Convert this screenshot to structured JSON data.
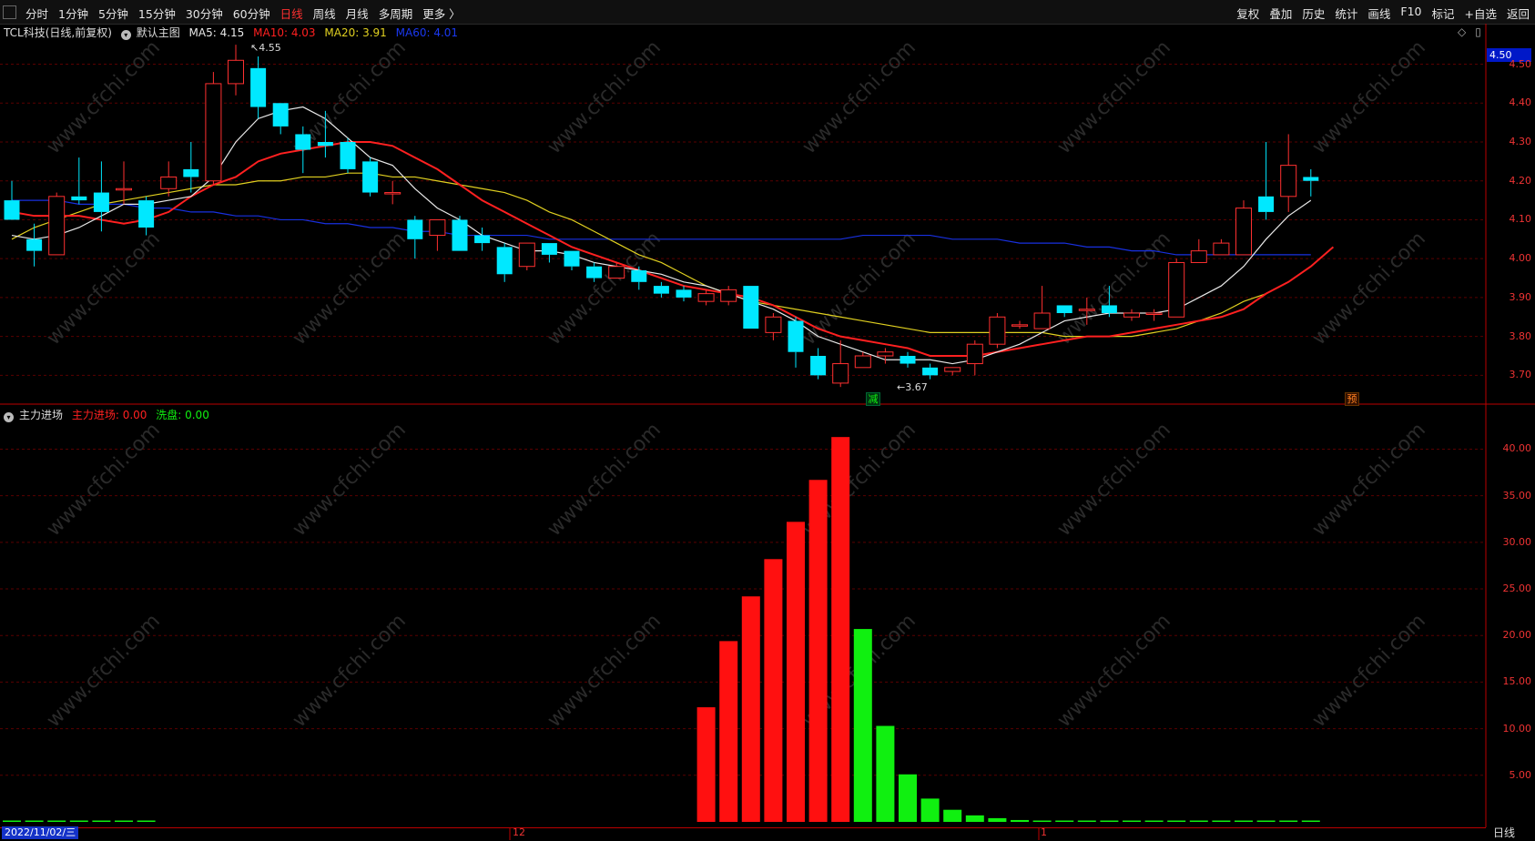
{
  "toolbar": {
    "left_items": [
      "分时",
      "1分钟",
      "5分钟",
      "15分钟",
      "30分钟",
      "60分钟",
      "日线",
      "周线",
      "月线",
      "多周期",
      "更多 〉"
    ],
    "active": "日线",
    "right_items": [
      "复权",
      "叠加",
      "历史",
      "统计",
      "画线",
      "F10",
      "标记",
      "+自选",
      "返回"
    ]
  },
  "main_panel": {
    "stock_title": "TCL科技(日线,前复权)",
    "template": "默认主图",
    "ma5": "MA5: 4.15",
    "ma10": "MA10: 4.03",
    "ma20": "MA20: 3.91",
    "ma60": "MA60: 4.01",
    "current_price_tag": "4.50",
    "y_ticks": [
      "4.50",
      "4.40",
      "4.30",
      "4.20",
      "4.10",
      "4.00",
      "3.90",
      "3.80",
      "3.70"
    ],
    "high_label": "4.55",
    "low_label": "3.67",
    "mark_reduce": "减",
    "mark_pre": "预"
  },
  "sub_panel": {
    "indicator_name": "主力进场",
    "main_in": "主力进场: 0.00",
    "wash": "洗盘: 0.00",
    "y_ticks": [
      "40.00",
      "35.00",
      "30.00",
      "25.00",
      "20.00",
      "15.00",
      "10.00",
      "5.00"
    ]
  },
  "date_axis": {
    "cursor_date": "2022/11/02/三",
    "month_labels": [
      "12",
      "1"
    ],
    "period_tab": "日线"
  },
  "colors": {
    "up": "#ff3030",
    "down": "#00e8ff",
    "ma5": "#e8e8e8",
    "ma10": "#ff2020",
    "ma20": "#e0d020",
    "ma60": "#1830e0",
    "bar_red": "#ff1010",
    "bar_green": "#10f010"
  },
  "chart_data": {
    "type": "candlestick",
    "title": "TCL科技(日线,前复权)",
    "ylim": [
      3.64,
      4.52
    ],
    "candles": [
      {
        "o": 4.15,
        "h": 4.2,
        "l": 4.1,
        "c": 4.1
      },
      {
        "o": 4.05,
        "h": 4.09,
        "l": 3.98,
        "c": 4.02
      },
      {
        "o": 4.01,
        "h": 4.17,
        "l": 4.01,
        "c": 4.16
      },
      {
        "o": 4.16,
        "h": 4.26,
        "l": 4.14,
        "c": 4.15
      },
      {
        "o": 4.17,
        "h": 4.25,
        "l": 4.07,
        "c": 4.12
      },
      {
        "o": 4.18,
        "h": 4.25,
        "l": 4.14,
        "c": 4.18
      },
      {
        "o": 4.15,
        "h": 4.16,
        "l": 4.06,
        "c": 4.08
      },
      {
        "o": 4.18,
        "h": 4.25,
        "l": 4.16,
        "c": 4.21
      },
      {
        "o": 4.23,
        "h": 4.3,
        "l": 4.17,
        "c": 4.21
      },
      {
        "o": 4.2,
        "h": 4.48,
        "l": 4.19,
        "c": 4.45
      },
      {
        "o": 4.45,
        "h": 4.55,
        "l": 4.42,
        "c": 4.51
      },
      {
        "o": 4.49,
        "h": 4.52,
        "l": 4.36,
        "c": 4.39
      },
      {
        "o": 4.4,
        "h": 4.4,
        "l": 4.32,
        "c": 4.34
      },
      {
        "o": 4.32,
        "h": 4.34,
        "l": 4.22,
        "c": 4.28
      },
      {
        "o": 4.3,
        "h": 4.38,
        "l": 4.26,
        "c": 4.29
      },
      {
        "o": 4.3,
        "h": 4.31,
        "l": 4.22,
        "c": 4.23
      },
      {
        "o": 4.25,
        "h": 4.26,
        "l": 4.16,
        "c": 4.17
      },
      {
        "o": 4.17,
        "h": 4.2,
        "l": 4.14,
        "c": 4.17
      },
      {
        "o": 4.1,
        "h": 4.11,
        "l": 4.0,
        "c": 4.05
      },
      {
        "o": 4.06,
        "h": 4.1,
        "l": 4.02,
        "c": 4.1
      },
      {
        "o": 4.1,
        "h": 4.11,
        "l": 4.02,
        "c": 4.02
      },
      {
        "o": 4.06,
        "h": 4.08,
        "l": 4.02,
        "c": 4.04
      },
      {
        "o": 4.03,
        "h": 4.04,
        "l": 3.94,
        "c": 3.96
      },
      {
        "o": 3.98,
        "h": 4.04,
        "l": 3.97,
        "c": 4.04
      },
      {
        "o": 4.04,
        "h": 4.04,
        "l": 3.99,
        "c": 4.01
      },
      {
        "o": 4.02,
        "h": 4.02,
        "l": 3.97,
        "c": 3.98
      },
      {
        "o": 3.98,
        "h": 3.99,
        "l": 3.94,
        "c": 3.95
      },
      {
        "o": 3.95,
        "h": 3.99,
        "l": 3.95,
        "c": 3.98
      },
      {
        "o": 3.97,
        "h": 3.98,
        "l": 3.92,
        "c": 3.94
      },
      {
        "o": 3.93,
        "h": 3.94,
        "l": 3.9,
        "c": 3.91
      },
      {
        "o": 3.92,
        "h": 3.93,
        "l": 3.89,
        "c": 3.9
      },
      {
        "o": 3.89,
        "h": 3.92,
        "l": 3.88,
        "c": 3.91
      },
      {
        "o": 3.89,
        "h": 3.93,
        "l": 3.88,
        "c": 3.92
      },
      {
        "o": 3.93,
        "h": 3.93,
        "l": 3.82,
        "c": 3.82
      },
      {
        "o": 3.81,
        "h": 3.86,
        "l": 3.79,
        "c": 3.85
      },
      {
        "o": 3.84,
        "h": 3.85,
        "l": 3.72,
        "c": 3.76
      },
      {
        "o": 3.75,
        "h": 3.77,
        "l": 3.69,
        "c": 3.7
      },
      {
        "o": 3.68,
        "h": 3.79,
        "l": 3.67,
        "c": 3.73
      },
      {
        "o": 3.72,
        "h": 3.76,
        "l": 3.72,
        "c": 3.75
      },
      {
        "o": 3.75,
        "h": 3.77,
        "l": 3.73,
        "c": 3.76
      },
      {
        "o": 3.75,
        "h": 3.76,
        "l": 3.72,
        "c": 3.73
      },
      {
        "o": 3.72,
        "h": 3.73,
        "l": 3.69,
        "c": 3.7
      },
      {
        "o": 3.71,
        "h": 3.72,
        "l": 3.7,
        "c": 3.72
      },
      {
        "o": 3.73,
        "h": 3.79,
        "l": 3.7,
        "c": 3.78
      },
      {
        "o": 3.78,
        "h": 3.86,
        "l": 3.77,
        "c": 3.85
      },
      {
        "o": 3.83,
        "h": 3.84,
        "l": 3.82,
        "c": 3.83
      },
      {
        "o": 3.82,
        "h": 3.93,
        "l": 3.82,
        "c": 3.86
      },
      {
        "o": 3.88,
        "h": 3.88,
        "l": 3.85,
        "c": 3.86
      },
      {
        "o": 3.87,
        "h": 3.9,
        "l": 3.83,
        "c": 3.87
      },
      {
        "o": 3.88,
        "h": 3.93,
        "l": 3.85,
        "c": 3.86
      },
      {
        "o": 3.85,
        "h": 3.87,
        "l": 3.84,
        "c": 3.86
      },
      {
        "o": 3.86,
        "h": 3.87,
        "l": 3.84,
        "c": 3.86
      },
      {
        "o": 3.85,
        "h": 4.0,
        "l": 3.85,
        "c": 3.99
      },
      {
        "o": 3.99,
        "h": 4.05,
        "l": 3.99,
        "c": 4.02
      },
      {
        "o": 4.01,
        "h": 4.05,
        "l": 4.01,
        "c": 4.04
      },
      {
        "o": 4.01,
        "h": 4.15,
        "l": 4.01,
        "c": 4.13
      },
      {
        "o": 4.16,
        "h": 4.3,
        "l": 4.1,
        "c": 4.12
      },
      {
        "o": 4.16,
        "h": 4.32,
        "l": 4.12,
        "c": 4.24
      },
      {
        "o": 4.21,
        "h": 4.23,
        "l": 4.16,
        "c": 4.2
      }
    ],
    "ma5": [
      4.06,
      4.05,
      4.06,
      4.08,
      4.11,
      4.14,
      4.14,
      4.15,
      4.16,
      4.21,
      4.3,
      4.36,
      4.38,
      4.39,
      4.36,
      4.31,
      4.26,
      4.24,
      4.18,
      4.13,
      4.1,
      4.06,
      4.04,
      4.02,
      4.02,
      4.01,
      3.99,
      3.98,
      3.97,
      3.96,
      3.94,
      3.93,
      3.91,
      3.89,
      3.87,
      3.84,
      3.8,
      3.78,
      3.76,
      3.74,
      3.74,
      3.74,
      3.73,
      3.74,
      3.76,
      3.78,
      3.81,
      3.84,
      3.85,
      3.86,
      3.86,
      3.86,
      3.87,
      3.9,
      3.93,
      3.98,
      4.05,
      4.11,
      4.15
    ],
    "ma10": [
      4.12,
      4.11,
      4.11,
      4.11,
      4.1,
      4.09,
      4.1,
      4.12,
      4.16,
      4.19,
      4.21,
      4.25,
      4.27,
      4.28,
      4.29,
      4.3,
      4.3,
      4.29,
      4.26,
      4.23,
      4.19,
      4.15,
      4.12,
      4.09,
      4.06,
      4.03,
      4.01,
      3.99,
      3.97,
      3.95,
      3.93,
      3.92,
      3.91,
      3.9,
      3.88,
      3.85,
      3.82,
      3.8,
      3.79,
      3.78,
      3.77,
      3.75,
      3.75,
      3.75,
      3.76,
      3.77,
      3.78,
      3.79,
      3.8,
      3.8,
      3.81,
      3.82,
      3.83,
      3.84,
      3.85,
      3.87,
      3.91,
      3.94,
      3.98,
      4.03
    ],
    "ma20": [
      4.05,
      4.08,
      4.1,
      4.12,
      4.14,
      4.15,
      4.16,
      4.17,
      4.18,
      4.19,
      4.19,
      4.2,
      4.2,
      4.21,
      4.21,
      4.22,
      4.22,
      4.21,
      4.21,
      4.2,
      4.19,
      4.18,
      4.17,
      4.15,
      4.12,
      4.1,
      4.07,
      4.04,
      4.01,
      3.99,
      3.96,
      3.93,
      3.91,
      3.89,
      3.88,
      3.87,
      3.86,
      3.85,
      3.84,
      3.83,
      3.82,
      3.81,
      3.81,
      3.81,
      3.81,
      3.81,
      3.81,
      3.8,
      3.8,
      3.8,
      3.8,
      3.81,
      3.82,
      3.84,
      3.86,
      3.89,
      3.91
    ],
    "ma60": [
      4.15,
      4.15,
      4.15,
      4.14,
      4.14,
      4.14,
      4.13,
      4.13,
      4.12,
      4.12,
      4.11,
      4.11,
      4.1,
      4.1,
      4.09,
      4.09,
      4.08,
      4.08,
      4.07,
      4.07,
      4.06,
      4.06,
      4.06,
      4.06,
      4.05,
      4.05,
      4.05,
      4.05,
      4.05,
      4.05,
      4.05,
      4.05,
      4.05,
      4.05,
      4.05,
      4.05,
      4.05,
      4.05,
      4.06,
      4.06,
      4.06,
      4.06,
      4.05,
      4.05,
      4.05,
      4.04,
      4.04,
      4.04,
      4.03,
      4.03,
      4.02,
      4.02,
      4.01,
      4.01,
      4.01,
      4.01,
      4.01,
      4.01,
      4.01
    ],
    "sub_ylim": [
      0,
      42
    ],
    "sub_bars": [
      {
        "i": 0,
        "v": 0.1,
        "c": "green"
      },
      {
        "i": 1,
        "v": 0.1,
        "c": "green"
      },
      {
        "i": 2,
        "v": 0.1,
        "c": "green"
      },
      {
        "i": 3,
        "v": 0.1,
        "c": "green"
      },
      {
        "i": 4,
        "v": 0.1,
        "c": "green"
      },
      {
        "i": 5,
        "v": 0.1,
        "c": "green"
      },
      {
        "i": 6,
        "v": 0.1,
        "c": "green"
      },
      {
        "i": 31,
        "v": 12.3,
        "c": "red"
      },
      {
        "i": 32,
        "v": 19.4,
        "c": "red"
      },
      {
        "i": 33,
        "v": 24.2,
        "c": "red"
      },
      {
        "i": 34,
        "v": 28.2,
        "c": "red"
      },
      {
        "i": 35,
        "v": 32.2,
        "c": "red"
      },
      {
        "i": 36,
        "v": 36.7,
        "c": "red"
      },
      {
        "i": 37,
        "v": 41.3,
        "c": "red"
      },
      {
        "i": 38,
        "v": 20.7,
        "c": "green"
      },
      {
        "i": 39,
        "v": 10.3,
        "c": "green"
      },
      {
        "i": 40,
        "v": 5.1,
        "c": "green"
      },
      {
        "i": 41,
        "v": 2.5,
        "c": "green"
      },
      {
        "i": 42,
        "v": 1.3,
        "c": "green"
      },
      {
        "i": 43,
        "v": 0.7,
        "c": "green"
      },
      {
        "i": 44,
        "v": 0.4,
        "c": "green"
      },
      {
        "i": 45,
        "v": 0.2,
        "c": "green"
      },
      {
        "i": 46,
        "v": 0.1,
        "c": "green"
      },
      {
        "i": 47,
        "v": 0.1,
        "c": "green"
      },
      {
        "i": 48,
        "v": 0.1,
        "c": "green"
      },
      {
        "i": 49,
        "v": 0.1,
        "c": "green"
      },
      {
        "i": 50,
        "v": 0.1,
        "c": "green"
      },
      {
        "i": 51,
        "v": 0.1,
        "c": "green"
      },
      {
        "i": 52,
        "v": 0.1,
        "c": "green"
      },
      {
        "i": 53,
        "v": 0.1,
        "c": "green"
      },
      {
        "i": 54,
        "v": 0.1,
        "c": "green"
      },
      {
        "i": 55,
        "v": 0.1,
        "c": "green"
      },
      {
        "i": 56,
        "v": 0.1,
        "c": "green"
      },
      {
        "i": 57,
        "v": 0.1,
        "c": "green"
      },
      {
        "i": 58,
        "v": 0.1,
        "c": "green"
      }
    ]
  }
}
